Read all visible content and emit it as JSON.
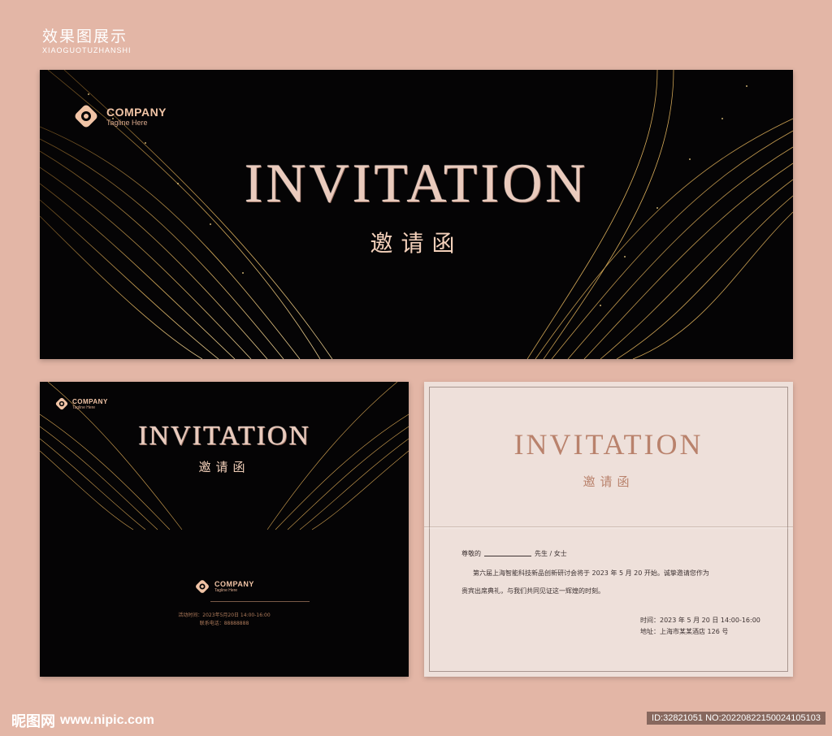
{
  "header": {
    "title": "效果图展示",
    "subtitle": "XIAOGUOTUZHANSHI"
  },
  "logo": {
    "name": "COMPANY",
    "tagline": "Tagline Here"
  },
  "cover": {
    "title": "INVITATION",
    "title_cn": "邀请函"
  },
  "back": {
    "info_time": "活动时间：2023年5月20日 14:00-16:00",
    "info_phone": "联系电话：88888888"
  },
  "inner": {
    "title": "INVITATION",
    "title_cn": "邀请函",
    "salutation": "尊敬的",
    "honorific": "先生 / 女士",
    "body_line1": "第六届上海智能科技新品创新研讨会将于 2023 年 5 月 20 开始。诚挚邀请您作为",
    "body_line2": "贵宾出席典礼，与我们共同见证这一辉煌的时刻。",
    "time": "时间：2023 年 5 月 20 日 14:00-16:00",
    "address": "地址：上海市某某酒店 126 号"
  },
  "watermark": {
    "site_cn": "昵图网",
    "url": "www.nipic.com",
    "id": "ID:32821051 NO:20220822150024105103"
  },
  "colors": {
    "page_bg": "#e3b6a6",
    "card_dark": "#050405",
    "gold": "#e8b35a",
    "rose": "#b9826c",
    "paper": "#eee0da"
  }
}
